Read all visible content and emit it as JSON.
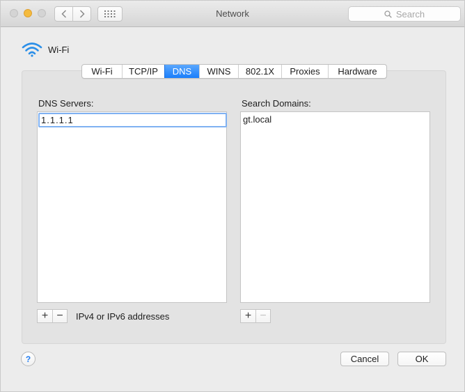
{
  "window": {
    "title": "Network",
    "search_placeholder": "Search"
  },
  "interface": {
    "name": "Wi-Fi"
  },
  "tabs": [
    {
      "label": "Wi-Fi"
    },
    {
      "label": "TCP/IP"
    },
    {
      "label": "DNS",
      "active": true
    },
    {
      "label": "WINS"
    },
    {
      "label": "802.1X"
    },
    {
      "label": "Proxies"
    },
    {
      "label": "Hardware"
    }
  ],
  "dns": {
    "label": "DNS Servers:",
    "servers": [
      "1.1.1.1"
    ],
    "hint": "IPv4 or IPv6 addresses",
    "add_label": "+",
    "remove_label": "−"
  },
  "search_domains": {
    "label": "Search Domains:",
    "domains": [
      "gt.local"
    ],
    "add_label": "+",
    "remove_label": "−"
  },
  "footer": {
    "help_label": "?",
    "cancel_label": "Cancel",
    "ok_label": "OK"
  },
  "colors": {
    "accent": "#1a7efb",
    "wifi_icon": "#2b8fe8"
  }
}
